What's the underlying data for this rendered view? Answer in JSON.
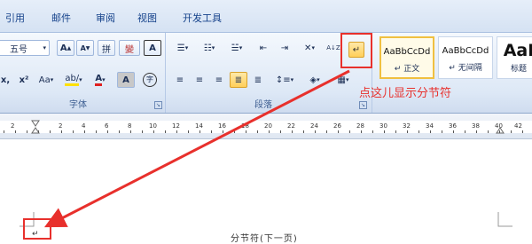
{
  "tabs": [
    "引用",
    "邮件",
    "审阅",
    "视图",
    "开发工具"
  ],
  "font_group": {
    "font_size": "五号",
    "grow_label": "A",
    "shrink_label": "A",
    "pinyin_label": "拼",
    "fanti_label": "變",
    "border_label": "A",
    "clear_label": "x,",
    "superscript_label": "x²",
    "case_label": "Aa",
    "highlight_label": "ab/",
    "color_label": "A",
    "shade_label": "A",
    "enclose_label": "字",
    "group_label": "字体"
  },
  "paragraph_group": {
    "sort_label": "A↓Z",
    "show_marks_label": "↵",
    "group_label": "段落"
  },
  "styles": [
    {
      "sample": "AaBbCcDd",
      "name": "↵ 正文"
    },
    {
      "sample": "AaBbCcDd",
      "name": "↵ 无间隔"
    },
    {
      "sample": "AaI",
      "name": "标题"
    }
  ],
  "ruler": [
    "2",
    "2",
    "4",
    "6",
    "8",
    "10",
    "12",
    "14",
    "16",
    "18",
    "20",
    "22",
    "24",
    "26",
    "28",
    "30",
    "32",
    "34",
    "36",
    "38",
    "40",
    "42"
  ],
  "annotation": "点这儿显示分节符",
  "section_break": "分节符(下一页)",
  "colors": {
    "highlight": "#e8302c",
    "accent_yellow": "#ffd75a"
  }
}
